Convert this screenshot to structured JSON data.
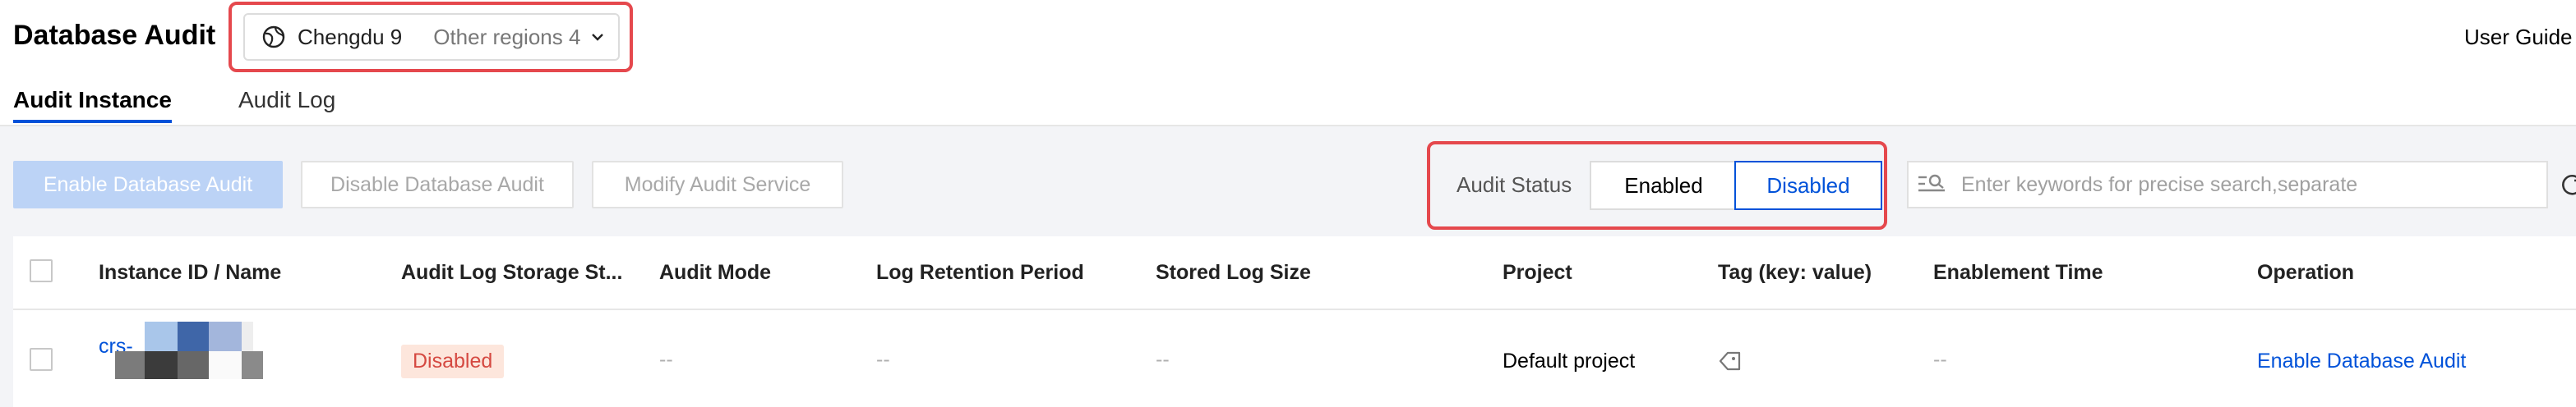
{
  "header": {
    "title": "Database Audit",
    "region_current": "Chengdu 9",
    "region_other": "Other regions 4",
    "user_guide": "User Guide"
  },
  "tabs": [
    {
      "label": "Audit Instance",
      "active": true
    },
    {
      "label": "Audit Log",
      "active": false
    }
  ],
  "toolbar": {
    "enable_label": "Enable Database Audit",
    "disable_label": "Disable Database Audit",
    "modify_label": "Modify Audit Service",
    "audit_status_label": "Audit Status",
    "status_options": [
      "Enabled",
      "Disabled"
    ],
    "status_selected": "Disabled",
    "search_placeholder": "Enter keywords for precise search,separate"
  },
  "table": {
    "columns": [
      "Instance ID / Name",
      "Audit Log Storage St...",
      "Audit Mode",
      "Log Retention Period",
      "Stored Log Size",
      "Project",
      "Tag (key: value)",
      "Enablement Time",
      "Operation"
    ],
    "rows": [
      {
        "instance_id": "crs-",
        "storage_status": "Disabled",
        "audit_mode": "--",
        "retention": "--",
        "stored_size": "--",
        "project": "Default project",
        "tag_icon": "tag-icon",
        "enablement_time": "--",
        "operation": "Enable Database Audit"
      }
    ]
  },
  "colors": {
    "accent": "#0052d9",
    "highlight_box": "#e5484d",
    "badge_bg": "#fde6dc",
    "badge_text": "#d54941"
  },
  "icons": [
    "globe-icon",
    "chevron-down-icon",
    "search-filter-icon",
    "refresh-icon",
    "tag-icon"
  ]
}
